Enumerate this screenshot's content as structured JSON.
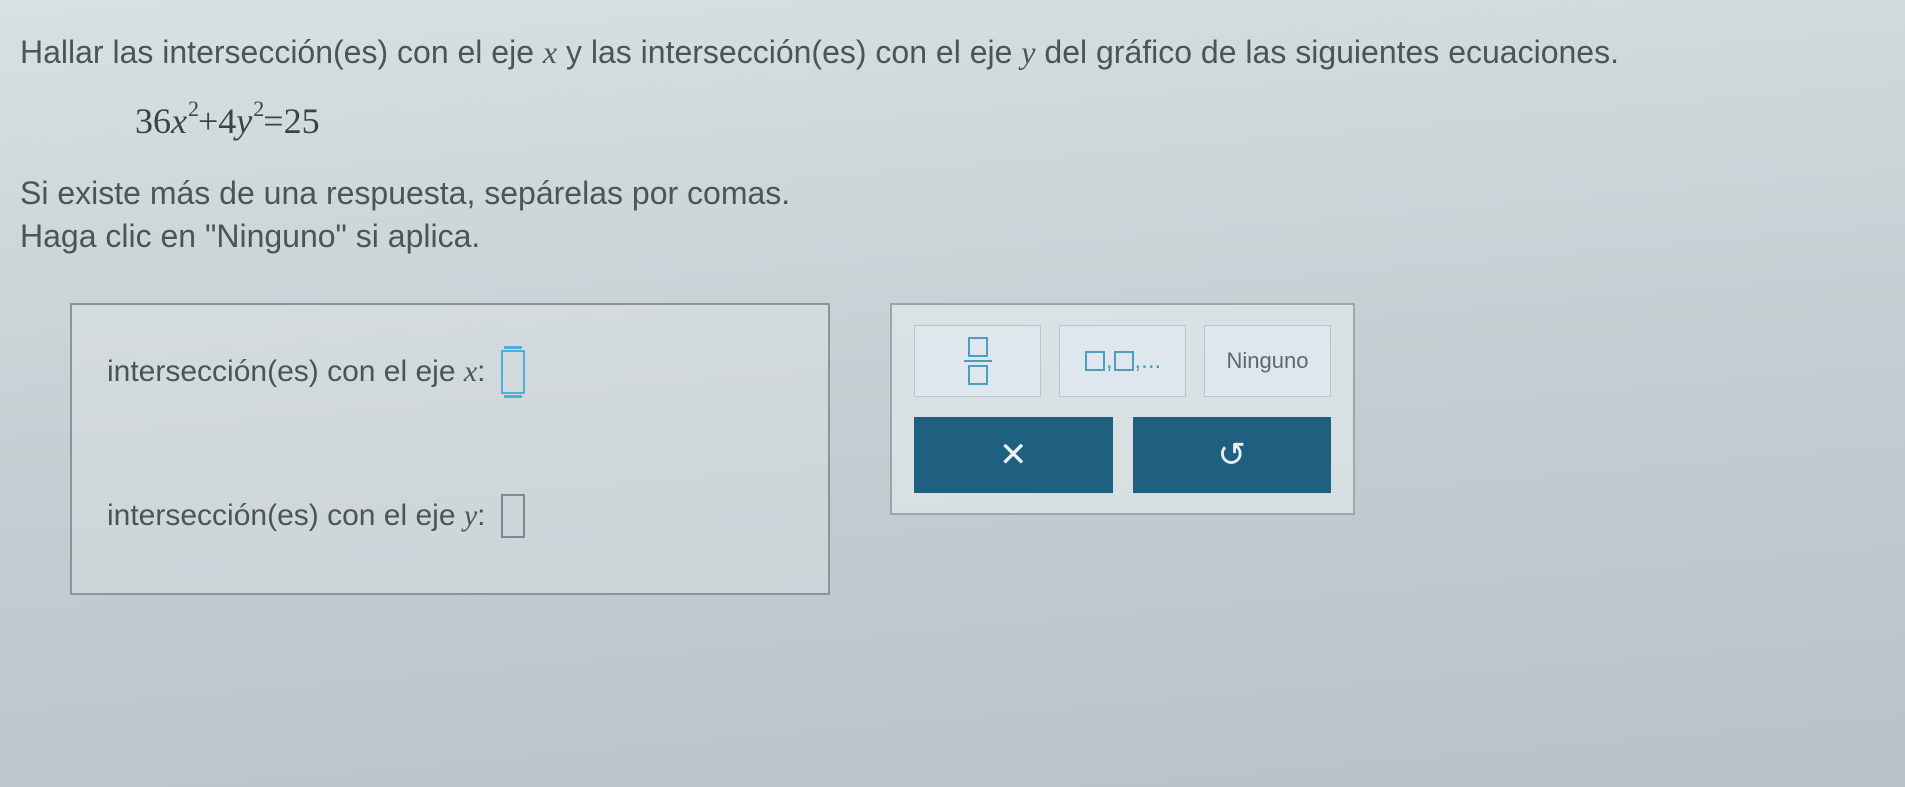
{
  "question": {
    "line1_pre": "Hallar las intersección(es) con el eje ",
    "line1_xvar": "x",
    "line1_mid": " y las intersección(es) con el eje ",
    "line1_yvar": "y",
    "line1_post": " del gráfico de las siguientes ecuaciones."
  },
  "equation": {
    "coef1": "36",
    "var1": "x",
    "exp1": "2",
    "plus": " + ",
    "coef2": "4",
    "var2": "y",
    "exp2": "2",
    "eq": " = ",
    "rhs": "25"
  },
  "instructions": {
    "line1": "Si existe más de una respuesta, sepárelas por comas.",
    "line2": "Haga clic en \"Ninguno\" si aplica."
  },
  "answers": {
    "x_label_pre": "intersección(es) con el eje ",
    "x_var": "x",
    "x_colon": ":",
    "y_label_pre": "intersección(es) con el eje ",
    "y_var": "y",
    "y_colon": ":"
  },
  "palette": {
    "list_text": ",",
    "list_ellipsis": ",...",
    "ninguno": "Ninguno",
    "close": "✕",
    "reset": "↺"
  }
}
